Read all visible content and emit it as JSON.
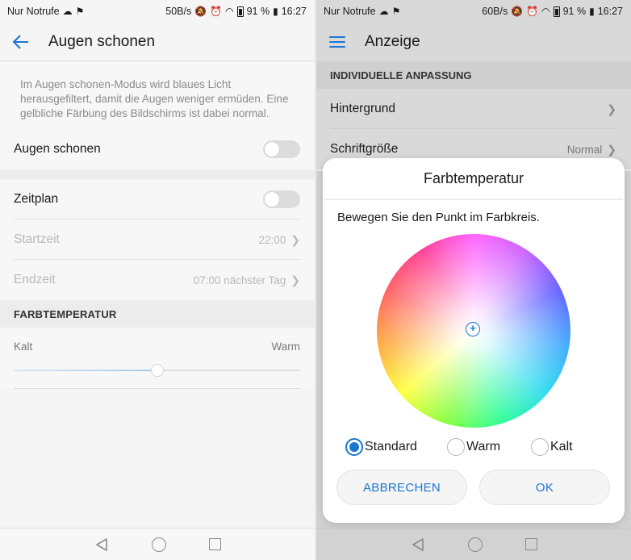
{
  "left": {
    "status": {
      "carrier": "Nur Notrufe",
      "speed": "50B/s",
      "battery": "91 %",
      "time": "16:27"
    },
    "title": "Augen schonen",
    "description": "Im Augen schonen-Modus wird blaues Licht herausgefiltert, damit die Augen weniger ermüden. Eine gelbliche Färbung des Bildschirms ist dabei normal.",
    "toggle_eye": {
      "label": "Augen schonen",
      "on": false
    },
    "toggle_schedule": {
      "label": "Zeitplan",
      "on": false
    },
    "start": {
      "label": "Startzeit",
      "value": "22:00"
    },
    "end": {
      "label": "Endzeit",
      "value": "07:00 nächster Tag"
    },
    "section": "FARBTEMPERATUR",
    "slider": {
      "min_label": "Kalt",
      "max_label": "Warm",
      "value_fraction": 0.5
    }
  },
  "right": {
    "status": {
      "carrier": "Nur Notrufe",
      "speed": "60B/s",
      "battery": "91 %",
      "time": "16:27"
    },
    "title": "Anzeige",
    "section": "INDIVIDUELLE ANPASSUNG",
    "rows": [
      {
        "label": "Hintergrund",
        "value": ""
      },
      {
        "label": "Schriftgröße",
        "value": "Normal"
      }
    ],
    "dialog": {
      "title": "Farbtemperatur",
      "hint": "Bewegen Sie den Punkt im Farbkreis.",
      "options": [
        "Standard",
        "Warm",
        "Kalt"
      ],
      "selected": "Standard",
      "cancel": "ABBRECHEN",
      "ok": "OK"
    }
  },
  "icons": {
    "back": "arrow-left-icon",
    "menu": "hamburger-icon",
    "chevron": "chevron-right-icon"
  },
  "colors": {
    "accent": "#1976d2"
  }
}
